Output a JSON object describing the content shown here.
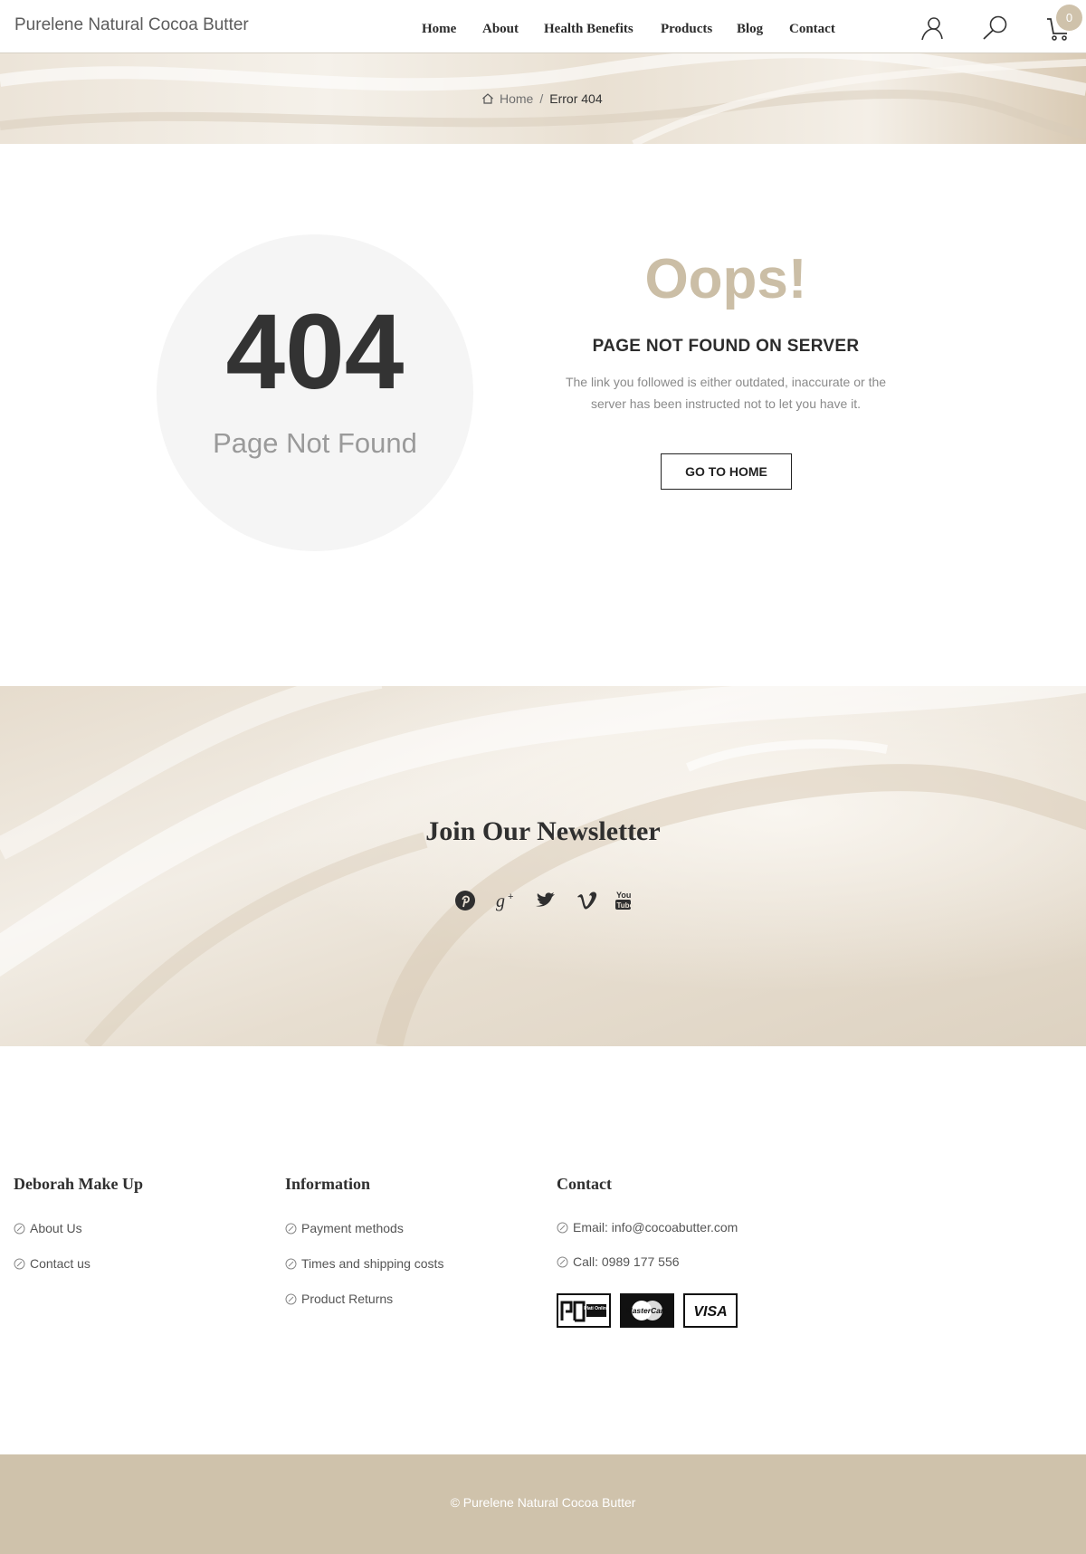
{
  "header": {
    "logo": "Purelene Natural Cocoa Butter",
    "nav": [
      "Home",
      "About",
      "Health Benefits",
      "Products",
      "Blog",
      "Contact"
    ],
    "cart_count": "0",
    "icons": [
      "user-icon",
      "search-icon",
      "cart-icon"
    ]
  },
  "breadcrumb": {
    "home": "Home",
    "separator": "/",
    "current": "Error 404"
  },
  "error": {
    "code": "404",
    "subtitle": "Page Not Found",
    "oops": "Oops!",
    "heading": "PAGE NOT FOUND ON SERVER",
    "description": "The link you followed is either outdated, inaccurate or the server has been instructed not to let you have it.",
    "button": "GO TO HOME"
  },
  "newsletter": {
    "title": "Join Our Newsletter",
    "social": [
      "pinterest-icon",
      "google-plus-icon",
      "twitter-icon",
      "vimeo-icon",
      "youtube-icon"
    ]
  },
  "footer": {
    "col1": {
      "title": "Deborah Make Up",
      "links": [
        "About Us",
        "Contact us"
      ]
    },
    "col2": {
      "title": "Information",
      "links": [
        "Payment methods",
        "Times and shipping costs",
        "Product Returns"
      ]
    },
    "col3": {
      "title": "Contact",
      "email": "Email: info@cocoabutter.com",
      "phone": "Call: 0989 177 556",
      "payment": [
        "Plati Online",
        "MasterCard",
        "VISA"
      ]
    },
    "copyright": "© Purelene Natural Cocoa Butter"
  },
  "colors": {
    "accent": "#cfc2ab",
    "oops": "#cbbea6",
    "circle": "#f5f5f5",
    "text_dark": "#333333"
  }
}
